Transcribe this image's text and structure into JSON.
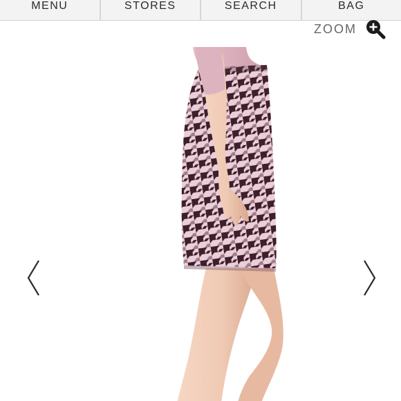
{
  "nav": {
    "items": [
      {
        "label": "MENU",
        "name": "menu-button"
      },
      {
        "label": "STORES",
        "name": "stores-button"
      },
      {
        "label": "SEARCH",
        "name": "search-button"
      },
      {
        "label": "BAG",
        "name": "bag-button"
      }
    ]
  },
  "zoom": {
    "label": "ZOOM",
    "icon": "zoom-in-icon"
  },
  "carousel": {
    "prev_icon": "chevron-left-icon",
    "next_icon": "chevron-right-icon"
  },
  "product_image": {
    "icon": "product-photo"
  },
  "colors": {
    "nav_bg": "#f3f3f3",
    "nav_text": "#2a2a2a",
    "zoom_text": "#666666",
    "skirt_light": "#e9cfd8",
    "skirt_dark": "#3e1f2b",
    "top": "#ddb3bf",
    "skin": "#efc9b3"
  }
}
